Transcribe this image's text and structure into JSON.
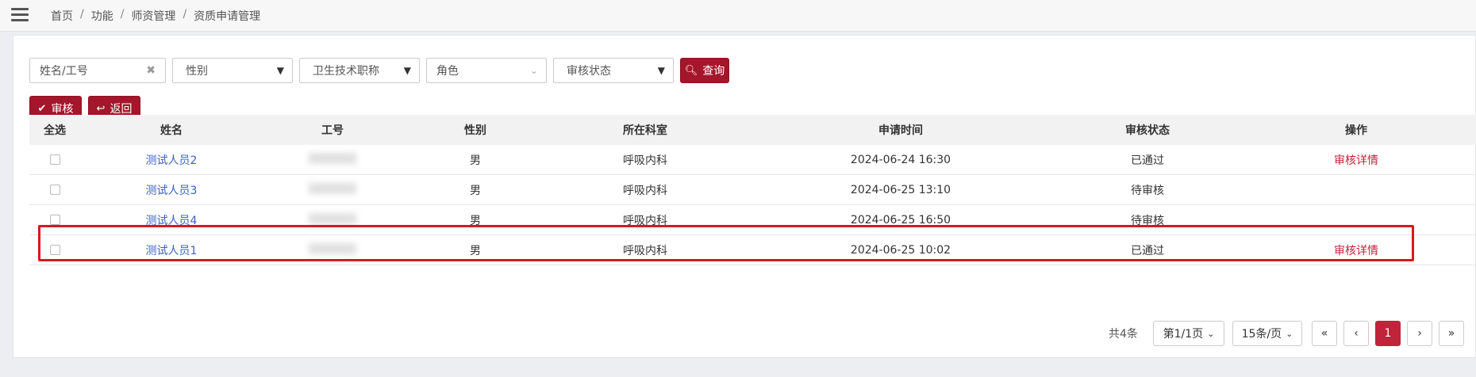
{
  "breadcrumb": [
    "首页",
    "功能",
    "师资管理",
    "资质申请管理"
  ],
  "filters": {
    "name_placeholder": "姓名/工号",
    "gender": "性别",
    "title": "卫生技术职称",
    "role": "角色",
    "status": "审核状态",
    "search_label": "查询"
  },
  "actions": {
    "review_label": "审核",
    "back_label": "返回"
  },
  "table": {
    "headers": [
      "全选",
      "姓名",
      "工号",
      "性别",
      "所在科室",
      "申请时间",
      "审核状态",
      "操作"
    ],
    "rows": [
      {
        "name": "测试人员2",
        "gender": "男",
        "dept": "呼吸内科",
        "time": "2024-06-24 16:30",
        "status": "已通过",
        "op": "审核详情"
      },
      {
        "name": "测试人员3",
        "gender": "男",
        "dept": "呼吸内科",
        "time": "2024-06-25 13:10",
        "status": "待审核",
        "op": ""
      },
      {
        "name": "测试人员4",
        "gender": "男",
        "dept": "呼吸内科",
        "time": "2024-06-25 16:50",
        "status": "待审核",
        "op": ""
      },
      {
        "name": "测试人员1",
        "gender": "男",
        "dept": "呼吸内科",
        "time": "2024-06-25 10:02",
        "status": "已通过",
        "op": "审核详情"
      }
    ]
  },
  "pagination": {
    "total": "共4条",
    "page_select": "第1/1页",
    "size_select": "15条/页",
    "first": "«",
    "prev": "‹",
    "current": "1",
    "next": "›",
    "last": "»"
  },
  "colors": {
    "primary": "#a4162b",
    "link": "#3a62c4",
    "highlight": "#d7191f"
  }
}
